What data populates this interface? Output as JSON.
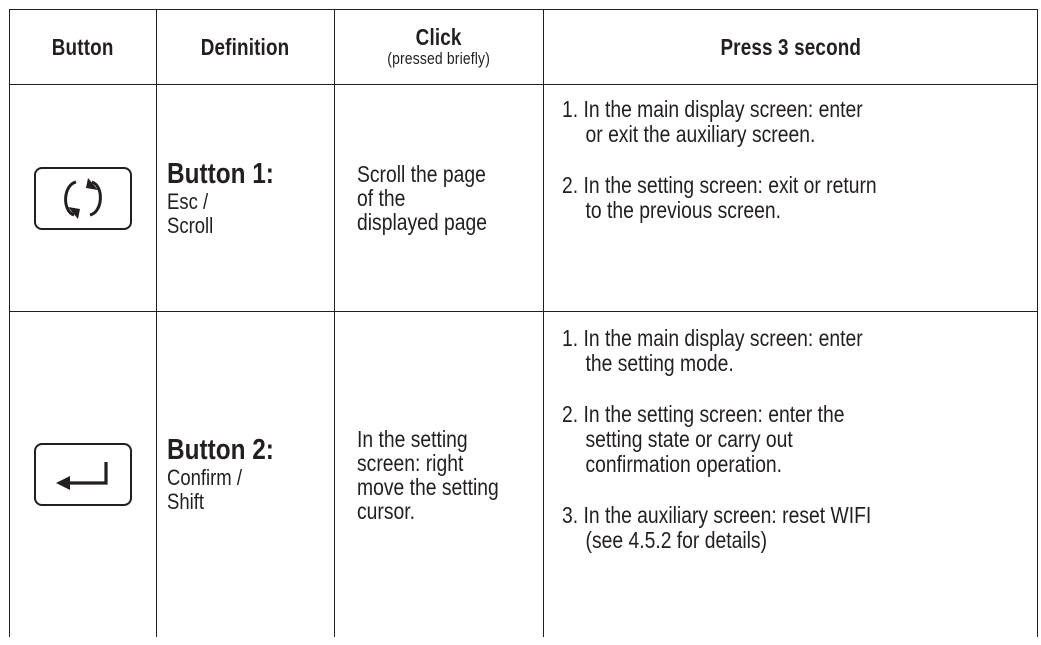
{
  "headers": {
    "button": "Button",
    "definition": "Definition",
    "click": "Click",
    "click_sub": "(pressed briefly)",
    "press": "Press 3 second"
  },
  "rows": [
    {
      "icon": "rotate-arrows-icon",
      "title": "Button 1:",
      "sub": [
        "Esc /",
        "Scroll"
      ],
      "click": [
        "Scroll the page",
        "of the",
        "displayed page"
      ],
      "press": [
        [
          "1. In the main display screen: enter",
          "or exit the auxiliary screen."
        ],
        [
          "2. In the setting screen: exit or return",
          "to the previous screen."
        ]
      ]
    },
    {
      "icon": "enter-arrow-icon",
      "title": "Button 2:",
      "sub": [
        "Confirm /",
        "Shift"
      ],
      "click": [
        "In the setting",
        "screen: right",
        "move the setting",
        "cursor."
      ],
      "press": [
        [
          "1. In the main display screen: enter",
          "the setting mode."
        ],
        [
          "2. In the setting screen: enter the",
          "setting state or carry out",
          "confirmation operation."
        ],
        [
          "3. In the auxiliary screen: reset WIFI",
          "(see 4.5.2 for details)"
        ]
      ]
    }
  ],
  "colors": {
    "ink": "#231f20",
    "background": "#ffffff"
  }
}
